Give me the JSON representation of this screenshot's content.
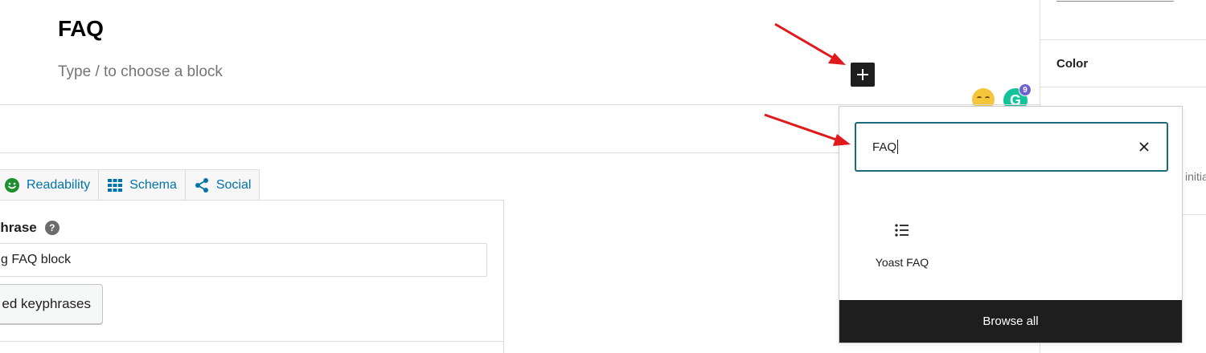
{
  "editor": {
    "post_title": "FAQ",
    "block_placeholder": "Type / to choose a block"
  },
  "grammarly": {
    "letter": "G",
    "badge_count": "9"
  },
  "yoast": {
    "tabs": [
      {
        "label": "Readability",
        "icon": "smiley-icon"
      },
      {
        "label": "Schema",
        "icon": "grid-icon"
      },
      {
        "label": "Social",
        "icon": "share-icon"
      }
    ],
    "keyphrase_label": "phrase",
    "help": "?",
    "keyphrase_value": "g FAQ block",
    "related_button_label": "ed keyphrases"
  },
  "sidebar": {
    "color_label": "Color",
    "cut_text": "initia"
  },
  "inserter": {
    "search_value": "FAQ",
    "result_label": "Yoast FAQ",
    "browse_all_label": "Browse all"
  },
  "colors": {
    "accent": "#0073aa",
    "search_border": "#1b6b7a",
    "dark": "#1e1e1e",
    "annotation_arrow": "#e0191c"
  }
}
